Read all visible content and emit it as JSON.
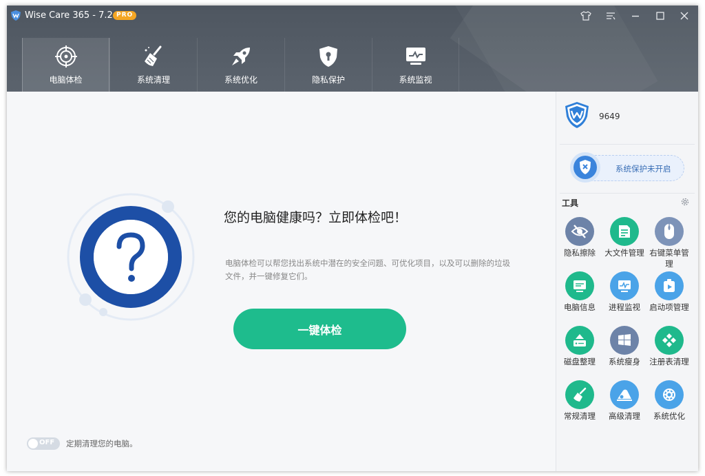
{
  "app": {
    "title": "Wise Care 365 - 7.2.6",
    "badge": "PRO"
  },
  "nav": {
    "tabs": [
      {
        "label": "电脑体检",
        "icon": "target-icon",
        "active": true
      },
      {
        "label": "系统清理",
        "icon": "broom-icon",
        "active": false
      },
      {
        "label": "系统优化",
        "icon": "rocket-icon",
        "active": false
      },
      {
        "label": "隐私保护",
        "icon": "shield-lock-icon",
        "active": false
      },
      {
        "label": "系统监视",
        "icon": "monitor-icon",
        "active": false
      }
    ]
  },
  "main": {
    "headline": "您的电脑健康吗？立即体检吧！",
    "description": "电脑体检可以帮您找出系统中潜在的安全问题、可优化项目，以及可以删除的垃圾文件，并一键修复它们。",
    "check_button": "一键体检",
    "toggle_state": "OFF",
    "schedule_text": "定期清理您的电脑。"
  },
  "sidebar": {
    "account_id": "9649",
    "protection_status": "系统保护未开启",
    "tools_title": "工具",
    "tools": [
      {
        "label": "隐私擦除",
        "icon": "eye-slash-icon",
        "color": "#6d83a8"
      },
      {
        "label": "大文件管理",
        "icon": "file-list-icon",
        "color": "#1fb98c"
      },
      {
        "label": "右键菜单管理",
        "icon": "mouse-icon",
        "color": "#7d93b8"
      },
      {
        "label": "电脑信息",
        "icon": "computer-info-icon",
        "color": "#1fb98c"
      },
      {
        "label": "进程监视",
        "icon": "process-monitor-icon",
        "color": "#4aa3e8"
      },
      {
        "label": "启动项管理",
        "icon": "startup-icon",
        "color": "#4aa3e8"
      },
      {
        "label": "磁盘整理",
        "icon": "disk-icon",
        "color": "#1fb98c"
      },
      {
        "label": "系统瘦身",
        "icon": "windows-icon",
        "color": "#6d83a8"
      },
      {
        "label": "注册表清理",
        "icon": "registry-icon",
        "color": "#1fb98c"
      },
      {
        "label": "常规清理",
        "icon": "brush-icon",
        "color": "#1fb98c"
      },
      {
        "label": "高级清理",
        "icon": "eraser-icon",
        "color": "#4aa3e8"
      },
      {
        "label": "系统优化",
        "icon": "gear-icon",
        "color": "#4aa3e8"
      }
    ]
  }
}
